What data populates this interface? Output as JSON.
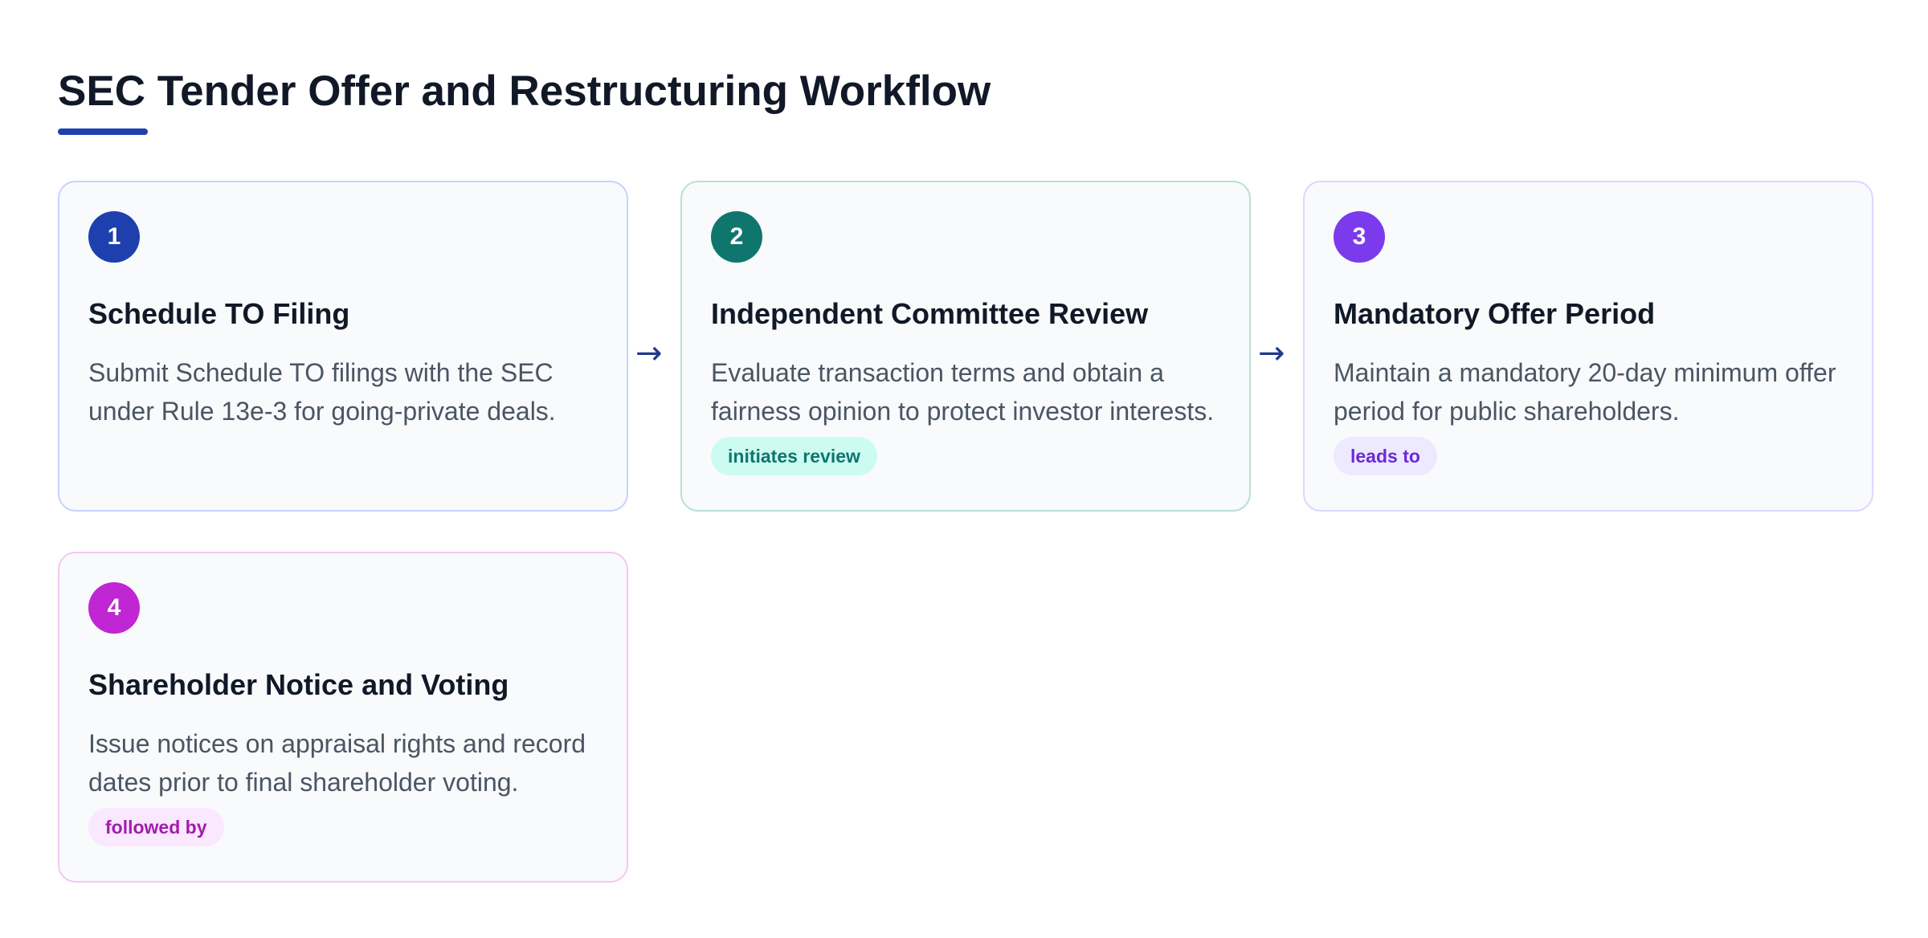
{
  "title": "SEC Tender Offer and Restructuring Workflow",
  "colors": {
    "title_underline": "#1e40af",
    "arrow": "#1e3a8a"
  },
  "arrows": [
    "→",
    "→"
  ],
  "steps": [
    {
      "number": "1",
      "title": "Schedule TO Filing",
      "description": "Submit Schedule TO filings with the SEC under Rule 13e-3 for going-private deals.",
      "tag": "",
      "badge_color": "#1e40af"
    },
    {
      "number": "2",
      "title": "Independent Committee Review",
      "description": "Evaluate transaction terms and obtain a fairness opinion to protect investor interests.",
      "tag": "initiates review",
      "badge_color": "#0f766e",
      "tag_bg": "#ccfbf1",
      "tag_color": "#0f766e"
    },
    {
      "number": "3",
      "title": "Mandatory Offer Period",
      "description": "Maintain a mandatory 20-day minimum offer period for public shareholders.",
      "tag": "leads to",
      "badge_color": "#7c3aed",
      "tag_bg": "#ede9fe",
      "tag_color": "#6d28d9"
    },
    {
      "number": "4",
      "title": "Shareholder Notice and Voting",
      "description": "Issue notices on appraisal rights and record dates prior to final shareholder voting.",
      "tag": "followed by",
      "badge_color": "#c026d3",
      "tag_bg": "#fae8ff",
      "tag_color": "#a21caf"
    }
  ]
}
